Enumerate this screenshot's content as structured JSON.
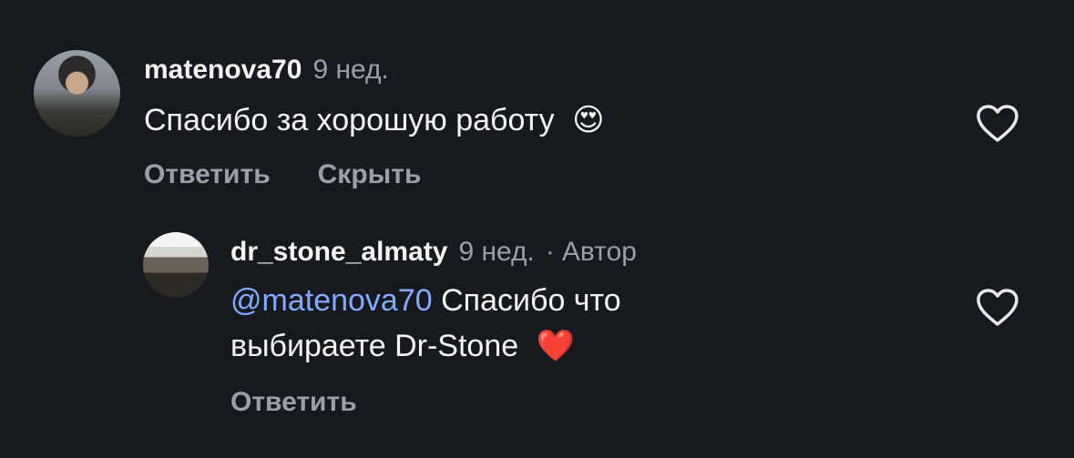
{
  "comments": [
    {
      "username": "matenova70",
      "time": "9 нед.",
      "text": "Спасибо  за хорошую работу",
      "emoji": "😍",
      "actions": {
        "reply": "Ответить",
        "hide": "Скрыть"
      }
    }
  ],
  "reply": {
    "username": "dr_stone_almaty",
    "time": "9 нед.",
    "separator": "·",
    "badge": "Автор",
    "mention": "@matenova70",
    "text": " Спасибо что выбираете Dr-Stone",
    "emoji": "❤️",
    "actions": {
      "reply": "Ответить"
    }
  },
  "icons": {
    "like": "heart-outline-icon",
    "colors": {
      "background": "#16191d",
      "mention": "#84a9ff",
      "muted": "#9aa0a6",
      "text": "#f5f5f5"
    }
  }
}
